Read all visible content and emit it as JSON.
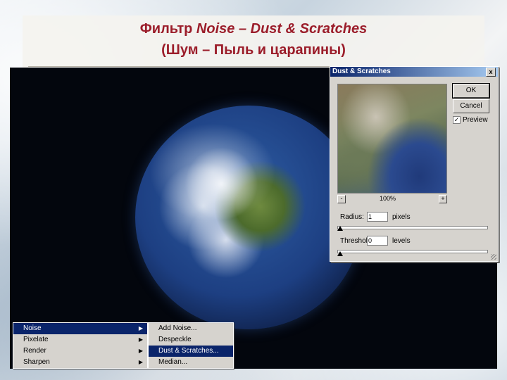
{
  "slide": {
    "title_line1_prefix": "Фильтр ",
    "title_line1_italic": "Noise – Dust & Scratches",
    "title_line2": "(Шум – Пыль и царапины)"
  },
  "dialog": {
    "title": "Dust & Scratches",
    "close_glyph": "x",
    "ok_label": "OK",
    "cancel_label": "Cancel",
    "preview_label": "Preview",
    "preview_checked": true,
    "zoom_minus": "-",
    "zoom_plus": "+",
    "zoom_level": "100%",
    "radius_label": "Radius:",
    "radius_value": "1",
    "radius_unit": "pixels",
    "radius_slider_fraction": 0.0,
    "threshold_label": "Threshold:",
    "threshold_value": "0",
    "threshold_unit": "levels",
    "threshold_slider_fraction": 0.0
  },
  "menu": {
    "categories": [
      {
        "label": "Noise",
        "selected": true
      },
      {
        "label": "Pixelate",
        "selected": false
      },
      {
        "label": "Render",
        "selected": false
      },
      {
        "label": "Sharpen",
        "selected": false
      }
    ],
    "submenu": [
      {
        "label": "Add Noise...",
        "selected": false
      },
      {
        "label": "Despeckle",
        "selected": false
      },
      {
        "label": "Dust & Scratches...",
        "selected": true
      },
      {
        "label": "Median...",
        "selected": false
      }
    ],
    "arrow_glyph": "▶"
  },
  "colors": {
    "title": "#9b1d2a",
    "menu_highlight": "#0a246a",
    "dialog_bg": "#d6d3ce"
  }
}
